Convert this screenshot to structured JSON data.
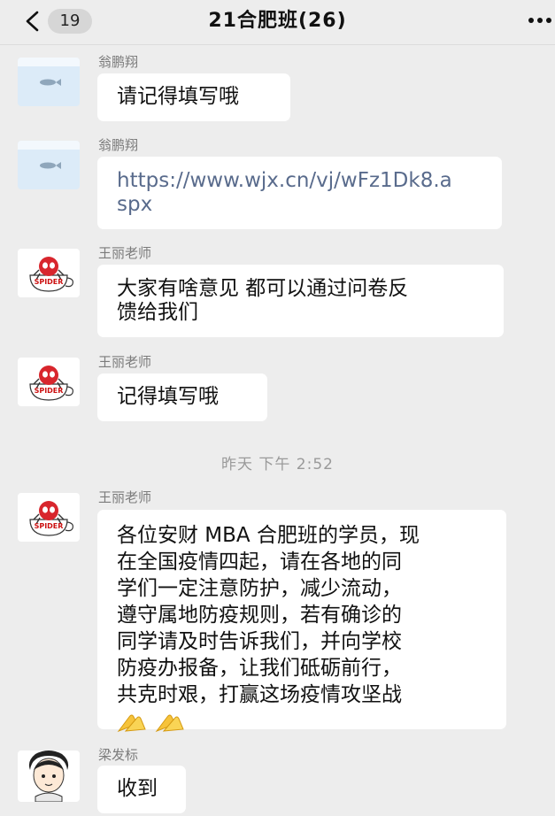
{
  "header": {
    "back_icon": "chevron-left-icon",
    "unread_count": "19",
    "title": "21合肥班(26)",
    "more_icon": "ellipsis-icon"
  },
  "timestamp": "昨天 下午 2:52",
  "messages": [
    {
      "sender": "翁鹏翔",
      "avatar_icon": "fish-icon",
      "text": "请记得填写哦"
    },
    {
      "sender": "翁鹏翔",
      "avatar_icon": "fish-icon",
      "lines": [
        "https://www.wjx.cn/vj/wFz1Dk8.a",
        "spx"
      ]
    },
    {
      "sender": "王丽老师",
      "avatar_icon": "spider-cup-icon",
      "lines": [
        "大家有啥意见 都可以通过问卷反",
        "馈给我们"
      ]
    },
    {
      "sender": "王丽老师",
      "avatar_icon": "spider-cup-icon",
      "text": "记得填写哦"
    },
    {
      "sender": "王丽老师",
      "avatar_icon": "spider-cup-icon",
      "lines": [
        "各位安财 MBA 合肥班的学员，现",
        "在全国疫情四起，请在各地的同",
        "学们一定注意防护，减少流动，",
        "遵守属地防疫规则，若有确诊的",
        "同学请及时告诉我们，并向学校",
        "防疫办报备，让我们砥砺前行，",
        "共克时艰，打赢这场疫情攻坚战"
      ],
      "emoji_icon": "praying-hands-icon"
    },
    {
      "sender": "梁发标",
      "avatar_icon": "cartoon-boy-icon",
      "text": "收到"
    }
  ],
  "colors": {
    "background": "#ededed",
    "bubble": "#ffffff",
    "link": "#596b8c",
    "sender": "#7b7b7b"
  }
}
